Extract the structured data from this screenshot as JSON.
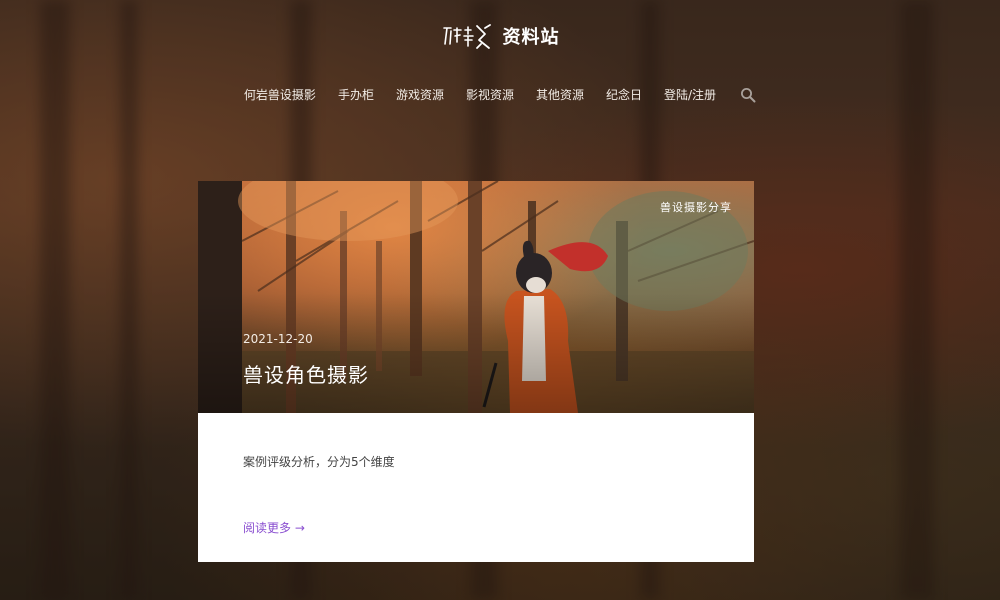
{
  "site": {
    "logo_text": "资料站",
    "logo_mark_icon": "handwritten-logo-icon",
    "logo_mark_text": "何岩"
  },
  "nav": {
    "items": [
      {
        "label": "何岩兽设摄影"
      },
      {
        "label": "手办柜"
      },
      {
        "label": "游戏资源"
      },
      {
        "label": "影视资源"
      },
      {
        "label": "其他资源"
      },
      {
        "label": "纪念日"
      },
      {
        "label": "登陆/注册"
      }
    ],
    "search_icon": "search-icon"
  },
  "post": {
    "category": "兽设摄影分享",
    "date": "2021-12-20",
    "title": "兽设角色摄影",
    "excerpt": "案例评级分析，分为5个维度",
    "read_more": "阅读更多 →"
  },
  "colors": {
    "accent": "#8a4fd0",
    "card_bg": "#ffffff",
    "nav_text": "#f2ece6"
  }
}
